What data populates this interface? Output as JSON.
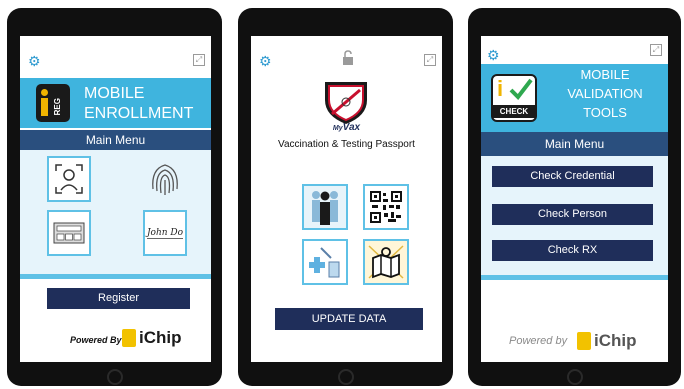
{
  "colors": {
    "accent": "#3fb4de",
    "navy": "#1f2e5a",
    "menubar": "#2a4f7e"
  },
  "tablet1": {
    "app_logo": "REG",
    "title_line1": "MOBILE",
    "title_line2": "ENROLLMENT",
    "menu_title": "Main Menu",
    "signature_text": "John Do",
    "register_button": "Register",
    "powered_by": "Powered By",
    "brand": "iChip"
  },
  "tablet2": {
    "logo_caption_prefix": "My",
    "logo_caption": "Vax",
    "subtitle": "Vaccination & Testing Passport",
    "update_button": "UPDATE DATA"
  },
  "tablet3": {
    "app_logo_letter": "i",
    "app_logo": "CHECK",
    "title_line1": "MOBILE",
    "title_line2": "VALIDATION",
    "title_line3": "TOOLS",
    "menu_title": "Main Menu",
    "buttons": [
      "Check Credential",
      "Check Person",
      "Check RX"
    ],
    "powered_by": "Powered by",
    "brand": "iChip"
  }
}
